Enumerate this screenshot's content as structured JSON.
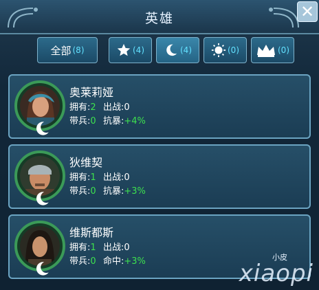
{
  "header": {
    "title": "英雄"
  },
  "filters": {
    "all": {
      "label": "全部",
      "count": "(8)"
    },
    "star": {
      "count": "(4)"
    },
    "moon": {
      "count": "(4)"
    },
    "sun": {
      "count": "(0)"
    },
    "crown": {
      "count": "(0)"
    }
  },
  "heroes": [
    {
      "name": "奥莱莉娅",
      "owned_label": "拥有:",
      "owned": "2",
      "battle_label": "出战:",
      "battle": "0",
      "troops_label": "带兵:",
      "troops": "0",
      "bonus_label": "抗暴:",
      "bonus": "+4%",
      "portrait": "female-hero-portrait",
      "badge": "moon-icon"
    },
    {
      "name": "狄维契",
      "owned_label": "拥有:",
      "owned": "1",
      "battle_label": "出战:",
      "battle": "0",
      "troops_label": "带兵:",
      "troops": "0",
      "bonus_label": "抗暴:",
      "bonus": "+3%",
      "portrait": "bandana-hero-portrait",
      "badge": "moon-icon"
    },
    {
      "name": "维斯都斯",
      "owned_label": "拥有:",
      "owned": "1",
      "battle_label": "出战:",
      "battle": "0",
      "troops_label": "带兵:",
      "troops": "0",
      "bonus_label": "命中:",
      "bonus": "+3%",
      "portrait": "longhair-hero-portrait",
      "badge": "moon-icon"
    }
  ],
  "watermark": {
    "small": "小皮",
    "large": "xiaopi"
  },
  "colors": {
    "accent": "#62e1ff",
    "positive": "#3ee04e",
    "ring": "#3b9a58"
  }
}
